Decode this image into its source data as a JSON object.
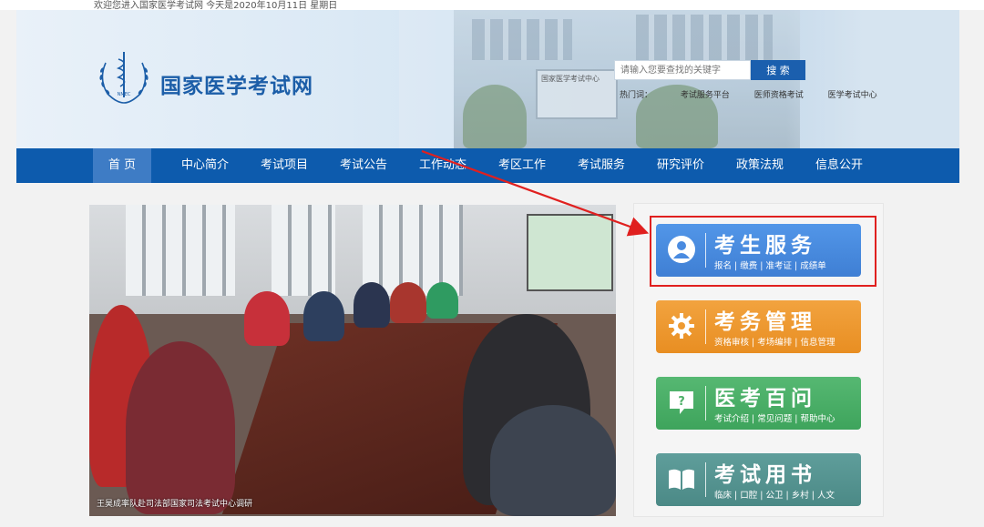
{
  "topbar": {
    "welcome": "欢迎您进入国家医学考试网     今天是2020年10月11日 星期日"
  },
  "header": {
    "site_title": "国家医学考试网",
    "emblem_text": "NMEC",
    "building_sign": "国家医学考试中心"
  },
  "search": {
    "placeholder": "请输入您要查找的关键字",
    "button_label": "搜 索"
  },
  "hotwords": {
    "label": "热门词：",
    "items": [
      "考试服务平台",
      "医师资格考试",
      "医学考试中心"
    ]
  },
  "nav": {
    "items": [
      {
        "label": "首 页",
        "active": true
      },
      {
        "label": "中心简介"
      },
      {
        "label": "考试项目"
      },
      {
        "label": "考试公告"
      },
      {
        "label": "工作动态"
      },
      {
        "label": "考区工作"
      },
      {
        "label": "考试服务"
      },
      {
        "label": "研究评价"
      },
      {
        "label": "政策法规"
      },
      {
        "label": "信息公开"
      }
    ]
  },
  "photo": {
    "caption": "王昊成率队赴司法部国家司法考试中心调研"
  },
  "services": [
    {
      "title": "考生服务",
      "sub": "报名 | 缴费 | 准考证 | 成绩单",
      "icon": "user-icon",
      "color": "#4a8be0"
    },
    {
      "title": "考务管理",
      "sub": "资格审核 | 考场编排 | 信息管理",
      "icon": "gear-icon",
      "color": "#ee9a31"
    },
    {
      "title": "医考百问",
      "sub": "考试介绍 | 常见问题 | 帮助中心",
      "icon": "question-bubble-icon",
      "color": "#4caf67"
    },
    {
      "title": "考试用书",
      "sub": "临床 | 口腔 | 公卫 | 乡村 | 人文",
      "icon": "book-icon",
      "color": "#56948f"
    }
  ],
  "annotation": {
    "color": "#e0201f"
  }
}
